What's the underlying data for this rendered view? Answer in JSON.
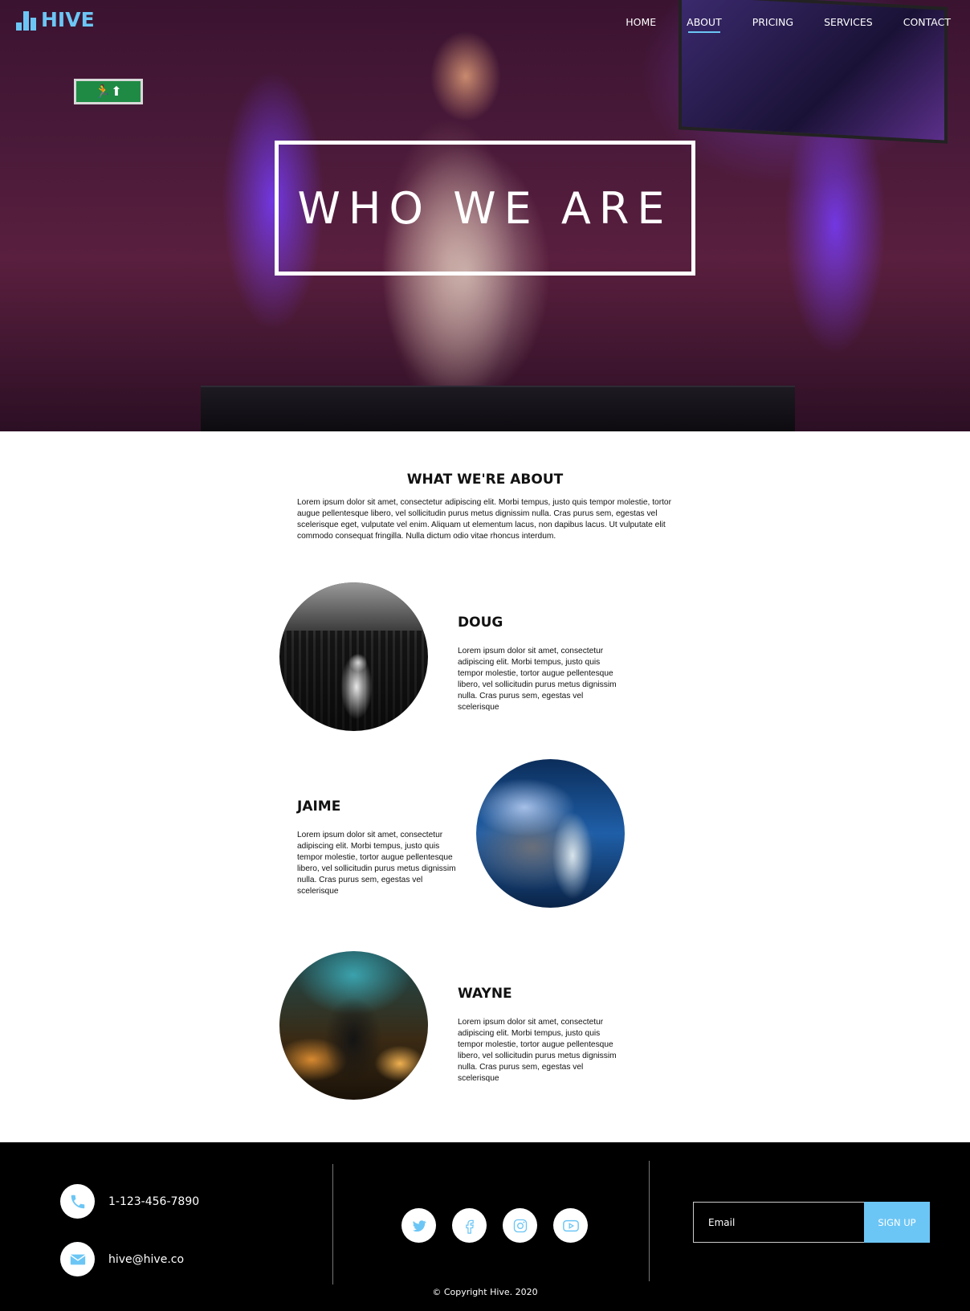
{
  "brand": {
    "name": "HIVE",
    "accent_color": "#6cc6f5"
  },
  "nav": {
    "items": [
      {
        "label": "HOME",
        "active": false
      },
      {
        "label": "ABOUT",
        "active": true
      },
      {
        "label": "PRICING",
        "active": false
      },
      {
        "label": "SERVICES",
        "active": false
      },
      {
        "label": "CONTACT",
        "active": false
      }
    ]
  },
  "hero": {
    "title": "WHO WE ARE"
  },
  "about": {
    "heading": "WHAT WE'RE ABOUT",
    "text": "Lorem ipsum dolor sit amet, consectetur adipiscing elit. Morbi tempus, justo quis tempor molestie, tortor augue pellentesque libero, vel sollicitudin purus metus dignissim nulla. Cras purus sem, egestas vel scelerisque eget, vulputate vel enim. Aliquam ut elementum lacus, non dapibus lacus. Ut vulputate elit commodo consequat fringilla. Nulla dictum odio vitae rhoncus interdum."
  },
  "team": [
    {
      "name": "DOUG",
      "bio": "Lorem ipsum dolor sit amet, consectetur adipiscing elit. Morbi tempus, justo quis tempor molestie, tortor augue pellentesque libero, vel sollicitudin purus metus dignissim nulla. Cras purus sem, egestas vel scelerisque"
    },
    {
      "name": "JAIME",
      "bio": "Lorem ipsum dolor sit amet, consectetur adipiscing elit. Morbi tempus, justo quis tempor molestie, tortor augue pellentesque libero, vel sollicitudin purus metus dignissim nulla. Cras purus sem, egestas vel scelerisque"
    },
    {
      "name": "WAYNE",
      "bio": "Lorem ipsum dolor sit amet, consectetur adipiscing elit. Morbi tempus, justo quis tempor molestie, tortor augue pellentesque libero, vel sollicitudin purus metus dignissim nulla. Cras purus sem, egestas vel scelerisque"
    }
  ],
  "footer": {
    "phone": "1-123-456-7890",
    "email": "hive@hive.co",
    "socials": [
      "twitter-icon",
      "facebook-icon",
      "instagram-icon",
      "youtube-icon"
    ],
    "signup": {
      "placeholder": "Email",
      "button_label": "SIGN UP"
    },
    "copyright": "© Copyright Hive. 2020"
  }
}
